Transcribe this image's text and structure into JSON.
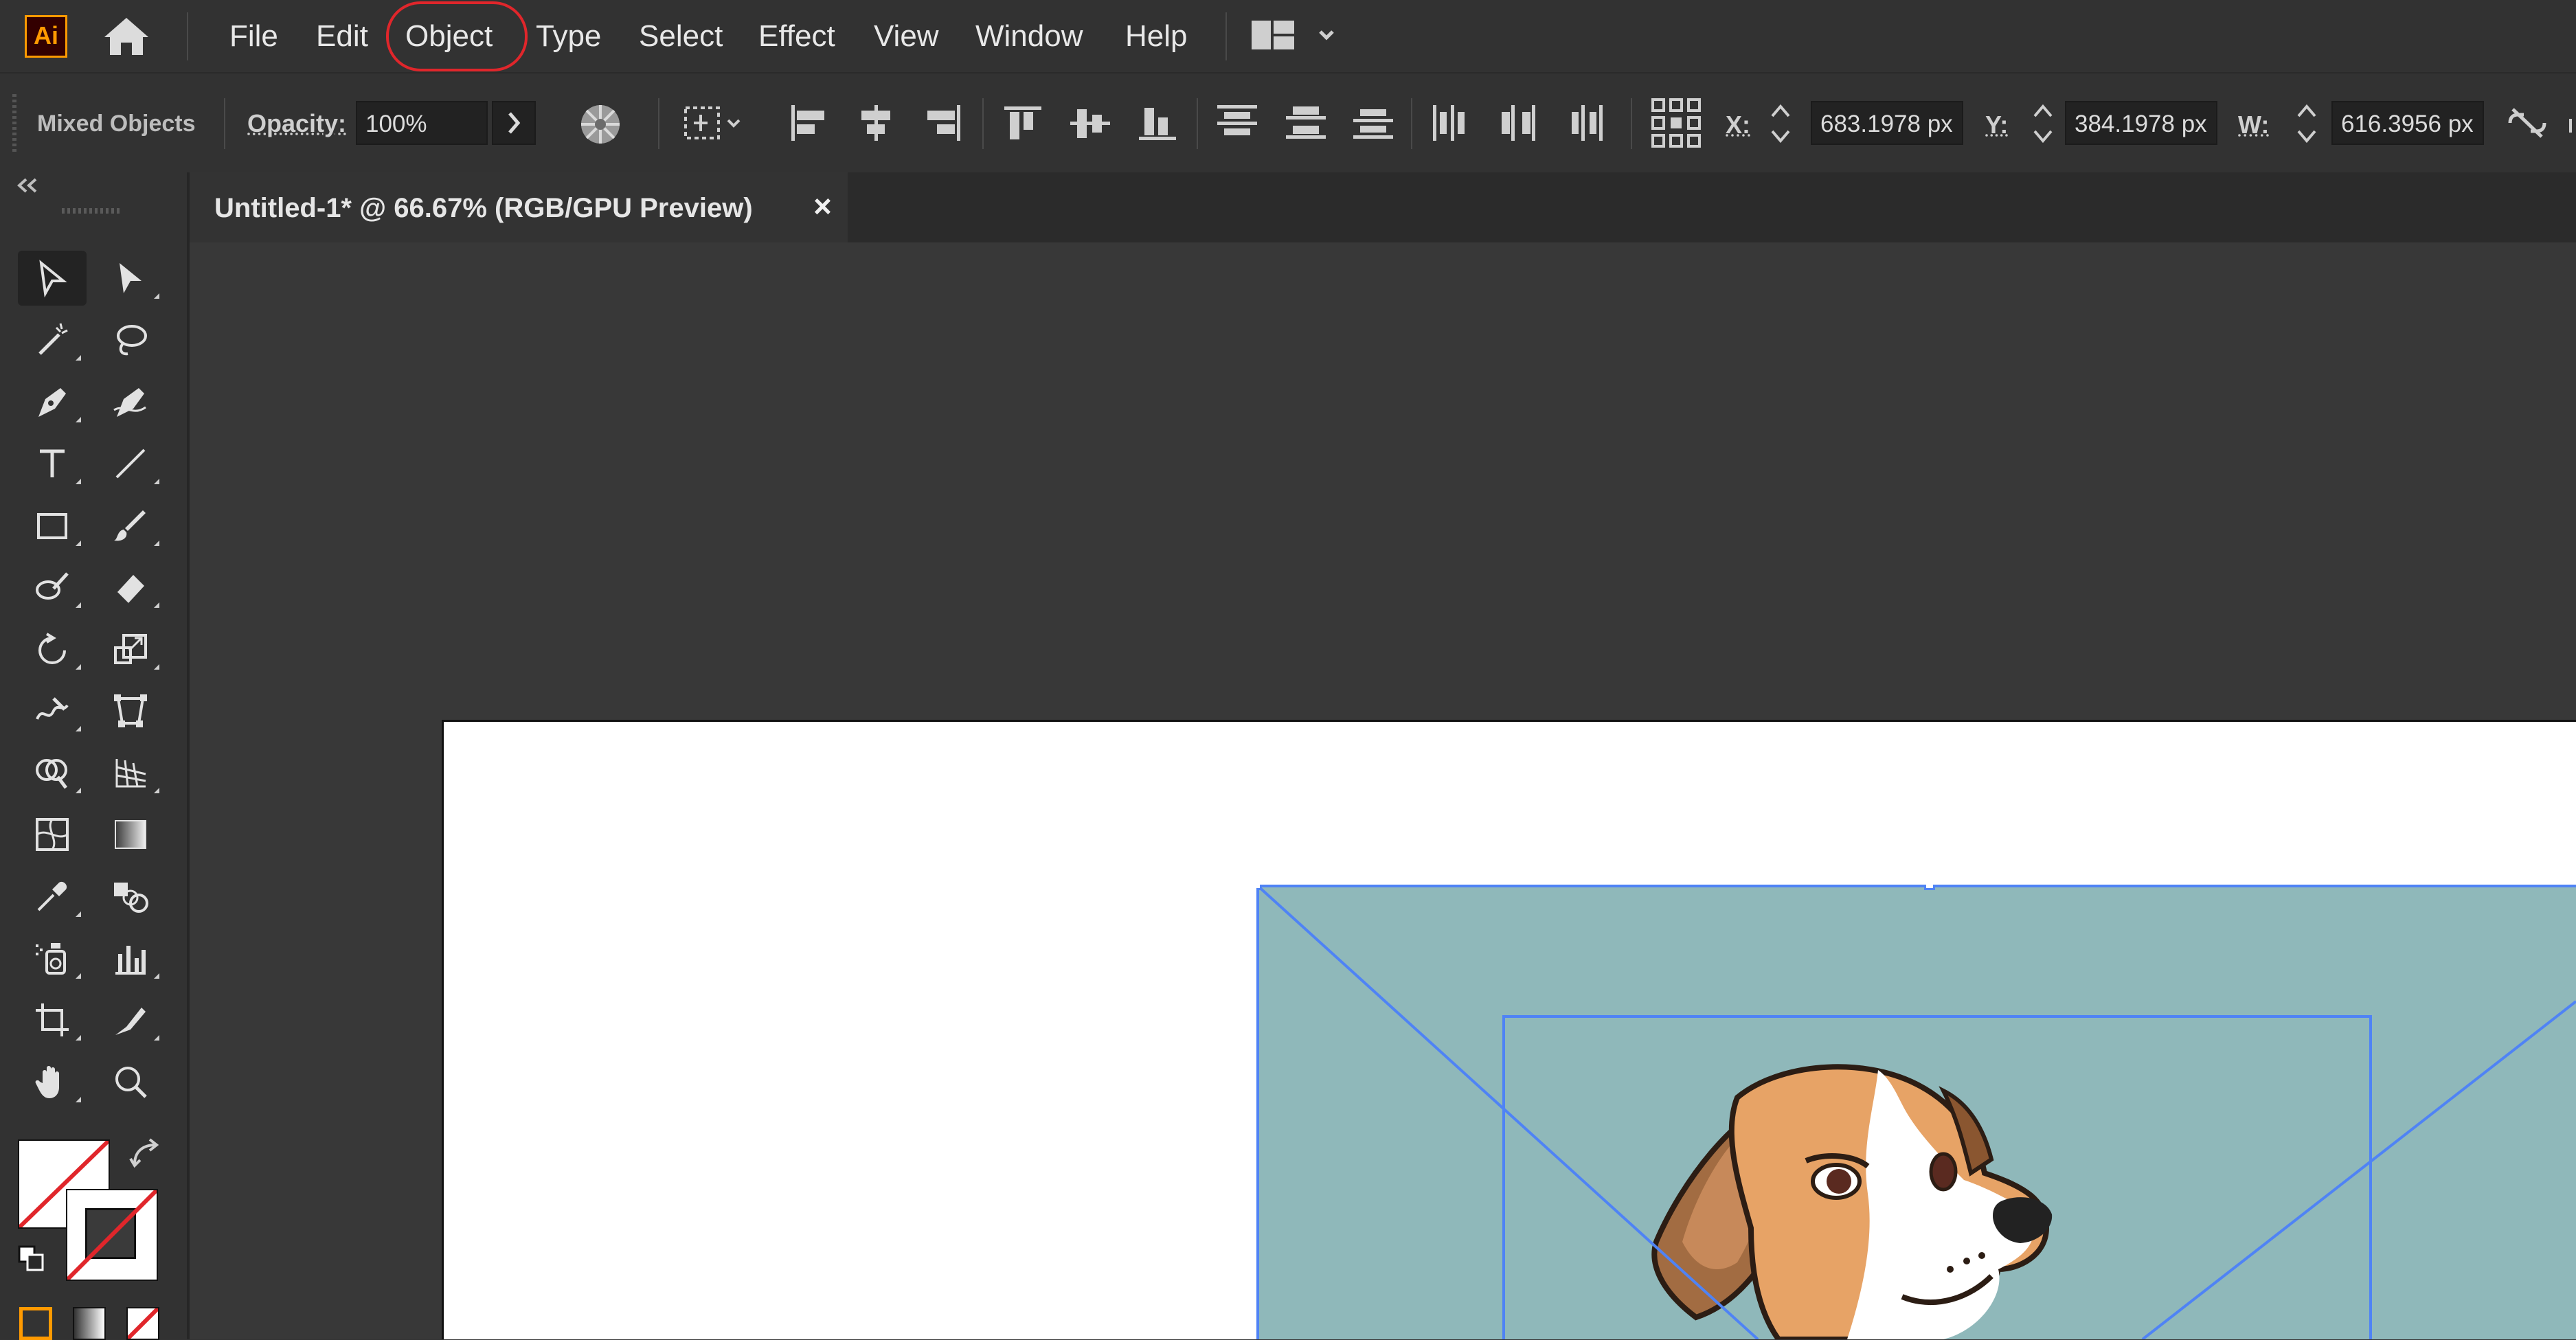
{
  "app": {
    "logo_text": "Ai",
    "accent": "#ff9a00",
    "logo_bg": "#330000"
  },
  "menu": {
    "items": [
      "File",
      "Edit",
      "Object",
      "Type",
      "Select",
      "Effect",
      "View",
      "Window",
      "Help"
    ],
    "highlighted": "Object",
    "highlight_color": "#e0262b"
  },
  "control_bar": {
    "selection_label": "Mixed Objects",
    "opacity_label": "Opacity:",
    "opacity_value": "100%",
    "x_label": "X:",
    "x_value": "683.1978 px",
    "y_label": "Y:",
    "y_value": "384.1978 px",
    "w_label": "W:",
    "w_value": "616.3956 px"
  },
  "document_tab": {
    "title": "Untitled-1* @ 66.67% (RGB/GPU Preview)",
    "close_glyph": "×"
  },
  "tools": [
    "selection-tool",
    "direct-selection-tool",
    "magic-wand-tool",
    "lasso-tool",
    "pen-tool",
    "curvature-tool",
    "type-tool",
    "line-segment-tool",
    "rectangle-tool",
    "paintbrush-tool",
    "shaper-tool",
    "eraser-tool",
    "rotate-tool",
    "scale-tool",
    "warp-tool",
    "free-transform-tool",
    "shape-builder-tool",
    "perspective-grid-tool",
    "mesh-tool",
    "gradient-tool",
    "eyedropper-tool",
    "blend-tool",
    "symbol-sprayer-tool",
    "column-graph-tool",
    "artboard-tool",
    "slice-tool",
    "hand-tool",
    "zoom-tool"
  ],
  "canvas": {
    "artwork": "beagle-illustration",
    "image_bg": "#8fb8ba",
    "selection_color": "#4f83f5"
  }
}
